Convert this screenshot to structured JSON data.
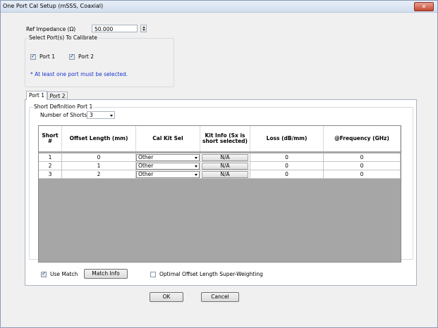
{
  "window": {
    "title": "One Port Cal Setup (mSSS, Coaxial)",
    "close_icon": "close-icon"
  },
  "ref_impedance": {
    "label": "Ref Impedance (Ω)",
    "value": "50.000"
  },
  "select_ports": {
    "group_title": "Select Port(s) To Calibrate",
    "port1_label": "Port 1",
    "port1_checked": true,
    "port2_label": "Port 2",
    "port2_checked": true,
    "warning": "* At least one port must be selected."
  },
  "tabs": [
    {
      "label": "Port 1",
      "active": true
    },
    {
      "label": "Port 2",
      "active": false
    }
  ],
  "short_definition": {
    "group_title": "Short Definition Port 1",
    "num_shorts_label": "Number of Shorts:",
    "num_shorts_value": "3"
  },
  "table": {
    "headers": [
      "Short #",
      "Offset Length (mm)",
      "Cal Kit Sel",
      "Kit Info (Sx is short selected)",
      "Loss (dB/mm)",
      "@Frequency (GHz)"
    ],
    "rows": [
      {
        "short": "1",
        "offset": "0",
        "calkit": "Other",
        "kitinfo": "N/A",
        "loss": "0",
        "freq": "0"
      },
      {
        "short": "2",
        "offset": "1",
        "calkit": "Other",
        "kitinfo": "N/A",
        "loss": "0",
        "freq": "0"
      },
      {
        "short": "3",
        "offset": "2",
        "calkit": "Other",
        "kitinfo": "N/A",
        "loss": "0",
        "freq": "0"
      }
    ]
  },
  "bottom_options": {
    "use_match_label": "Use Match",
    "use_match_checked": true,
    "match_info_label": "Match Info",
    "optimal_label": "Optimal Offset Length Super-Weighting",
    "optimal_checked": false
  },
  "footer": {
    "ok_label": "OK",
    "cancel_label": "Cancel"
  },
  "colors": {
    "warning_text": "#1a33cc",
    "grid_empty": "#a6a6a6",
    "close_button": "#c44a33"
  }
}
